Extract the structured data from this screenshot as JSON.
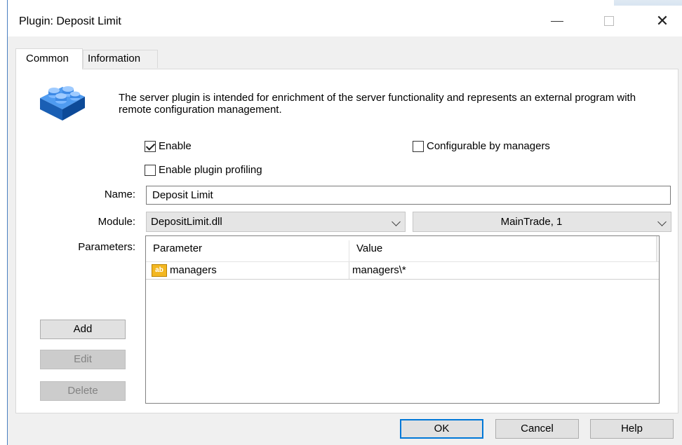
{
  "window": {
    "title": "Plugin: Deposit Limit"
  },
  "tabs": [
    {
      "label": "Common",
      "active": true
    },
    {
      "label": "Information",
      "active": false
    }
  ],
  "description": "The server plugin is intended for enrichment of the server functionality and represents an external program with remote configuration management.",
  "checkboxes": {
    "enable": {
      "label": "Enable",
      "checked": true
    },
    "configurable": {
      "label": "Configurable by managers",
      "checked": false
    },
    "profiling": {
      "label": "Enable plugin profiling",
      "checked": false
    }
  },
  "form": {
    "name_label": "Name:",
    "name_value": "Deposit Limit",
    "module_label": "Module:",
    "module_value": "DepositLimit.dll",
    "server_value": "MainTrade, 1",
    "parameters_label": "Parameters:"
  },
  "parameters_table": {
    "columns": [
      "Parameter",
      "Value"
    ],
    "rows": [
      {
        "icon": "string-param-icon",
        "icon_text": "ab",
        "parameter": "managers",
        "value": "managers\\*"
      }
    ]
  },
  "side_buttons": {
    "add": "Add",
    "edit": "Edit",
    "delete": "Delete"
  },
  "dialog_buttons": {
    "ok": "OK",
    "cancel": "Cancel",
    "help": "Help"
  },
  "colors": {
    "accent": "#0078d7",
    "icon_blue": "#1e6fd1",
    "param_icon": "#f3b721"
  }
}
